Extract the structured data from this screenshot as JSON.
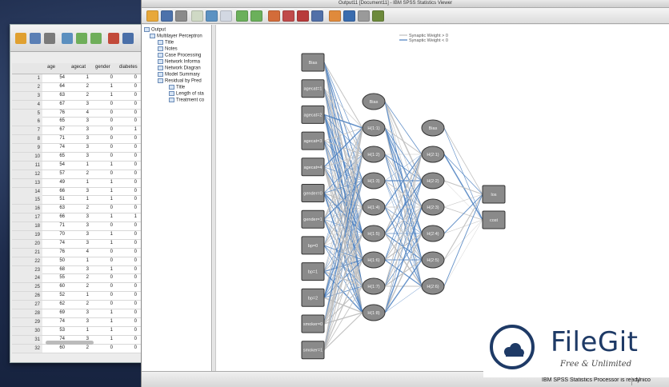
{
  "viewer": {
    "title": "Output11 [Document11] - IBM SPSS Statistics Viewer"
  },
  "outline": {
    "items": [
      "Output",
      "Multilayer Perceptron",
      "Title",
      "Notes",
      "Case Processing",
      "Network Informa",
      "Network Diagran",
      "Model Summary",
      "Residual by Pred",
      "Title",
      "Length of sta",
      "Treatment co"
    ]
  },
  "data_editor": {
    "columns": [
      "age",
      "agecat",
      "gender",
      "diabetes"
    ],
    "rows": [
      {
        "n": "1",
        "age": "54",
        "agecat": "1",
        "gender": "0",
        "diabetes": "0"
      },
      {
        "n": "2",
        "age": "64",
        "agecat": "2",
        "gender": "1",
        "diabetes": "0"
      },
      {
        "n": "3",
        "age": "63",
        "agecat": "2",
        "gender": "1",
        "diabetes": "0"
      },
      {
        "n": "4",
        "age": "67",
        "agecat": "3",
        "gender": "0",
        "diabetes": "0"
      },
      {
        "n": "5",
        "age": "76",
        "agecat": "4",
        "gender": "0",
        "diabetes": "0"
      },
      {
        "n": "6",
        "age": "65",
        "agecat": "3",
        "gender": "0",
        "diabetes": "0"
      },
      {
        "n": "7",
        "age": "67",
        "agecat": "3",
        "gender": "0",
        "diabetes": "1"
      },
      {
        "n": "8",
        "age": "71",
        "agecat": "3",
        "gender": "0",
        "diabetes": "0"
      },
      {
        "n": "9",
        "age": "74",
        "agecat": "3",
        "gender": "0",
        "diabetes": "0"
      },
      {
        "n": "10",
        "age": "65",
        "agecat": "3",
        "gender": "0",
        "diabetes": "0"
      },
      {
        "n": "11",
        "age": "54",
        "agecat": "1",
        "gender": "1",
        "diabetes": "0"
      },
      {
        "n": "12",
        "age": "57",
        "agecat": "2",
        "gender": "0",
        "diabetes": "0"
      },
      {
        "n": "13",
        "age": "49",
        "agecat": "1",
        "gender": "1",
        "diabetes": "0"
      },
      {
        "n": "14",
        "age": "66",
        "agecat": "3",
        "gender": "1",
        "diabetes": "0"
      },
      {
        "n": "15",
        "age": "51",
        "agecat": "1",
        "gender": "1",
        "diabetes": "0"
      },
      {
        "n": "16",
        "age": "63",
        "agecat": "2",
        "gender": "0",
        "diabetes": "0"
      },
      {
        "n": "17",
        "age": "66",
        "agecat": "3",
        "gender": "1",
        "diabetes": "1"
      },
      {
        "n": "18",
        "age": "71",
        "agecat": "3",
        "gender": "0",
        "diabetes": "0"
      },
      {
        "n": "19",
        "age": "70",
        "agecat": "3",
        "gender": "1",
        "diabetes": "0"
      },
      {
        "n": "20",
        "age": "74",
        "agecat": "3",
        "gender": "1",
        "diabetes": "0"
      },
      {
        "n": "21",
        "age": "76",
        "agecat": "4",
        "gender": "0",
        "diabetes": "0"
      },
      {
        "n": "22",
        "age": "50",
        "agecat": "1",
        "gender": "0",
        "diabetes": "0"
      },
      {
        "n": "23",
        "age": "68",
        "agecat": "3",
        "gender": "1",
        "diabetes": "0"
      },
      {
        "n": "24",
        "age": "55",
        "agecat": "2",
        "gender": "0",
        "diabetes": "0"
      },
      {
        "n": "25",
        "age": "60",
        "agecat": "2",
        "gender": "0",
        "diabetes": "0"
      },
      {
        "n": "26",
        "age": "52",
        "agecat": "1",
        "gender": "0",
        "diabetes": "0"
      },
      {
        "n": "27",
        "age": "62",
        "agecat": "2",
        "gender": "0",
        "diabetes": "0"
      },
      {
        "n": "28",
        "age": "69",
        "agecat": "3",
        "gender": "1",
        "diabetes": "0"
      },
      {
        "n": "29",
        "age": "74",
        "agecat": "3",
        "gender": "1",
        "diabetes": "0"
      },
      {
        "n": "30",
        "age": "53",
        "agecat": "1",
        "gender": "1",
        "diabetes": "0"
      },
      {
        "n": "31",
        "age": "74",
        "agecat": "3",
        "gender": "1",
        "diabetes": "0"
      },
      {
        "n": "32",
        "age": "60",
        "agecat": "2",
        "gender": "0",
        "diabetes": "0"
      }
    ]
  },
  "network": {
    "legend": [
      "Synaptic Weight > 0",
      "Synaptic Weight < 0"
    ],
    "colors": {
      "positive": "#bdbdbd",
      "negative": "#4a7fbf",
      "node": "#8a8a8a"
    },
    "input_nodes": [
      "Bias",
      "agecat=1",
      "agecat=2",
      "agecat=3",
      "agecat=4",
      "gender=0",
      "gender=1",
      "bp=0",
      "bp=1",
      "bp=2",
      "smoker=0",
      "smoker=1"
    ],
    "hidden1_nodes": [
      "Bias",
      "H(1:1)",
      "H(1:2)",
      "H(1:3)",
      "H(1:4)",
      "H(1:5)",
      "H(1:6)",
      "H(1:7)",
      "H(1:8)"
    ],
    "hidden2_nodes": [
      "Bias",
      "H(2:1)",
      "H(2:2)",
      "H(2:3)",
      "H(2:4)",
      "H(2:5)",
      "H(2:6)"
    ],
    "output_nodes": [
      "los",
      "cost"
    ]
  },
  "statusbar": {
    "processor": "IBM SPSS Statistics Processor is ready",
    "encoding": "Unico"
  },
  "watermark": {
    "brand": "FileGit",
    "tagline": "Free & Unlimited"
  }
}
